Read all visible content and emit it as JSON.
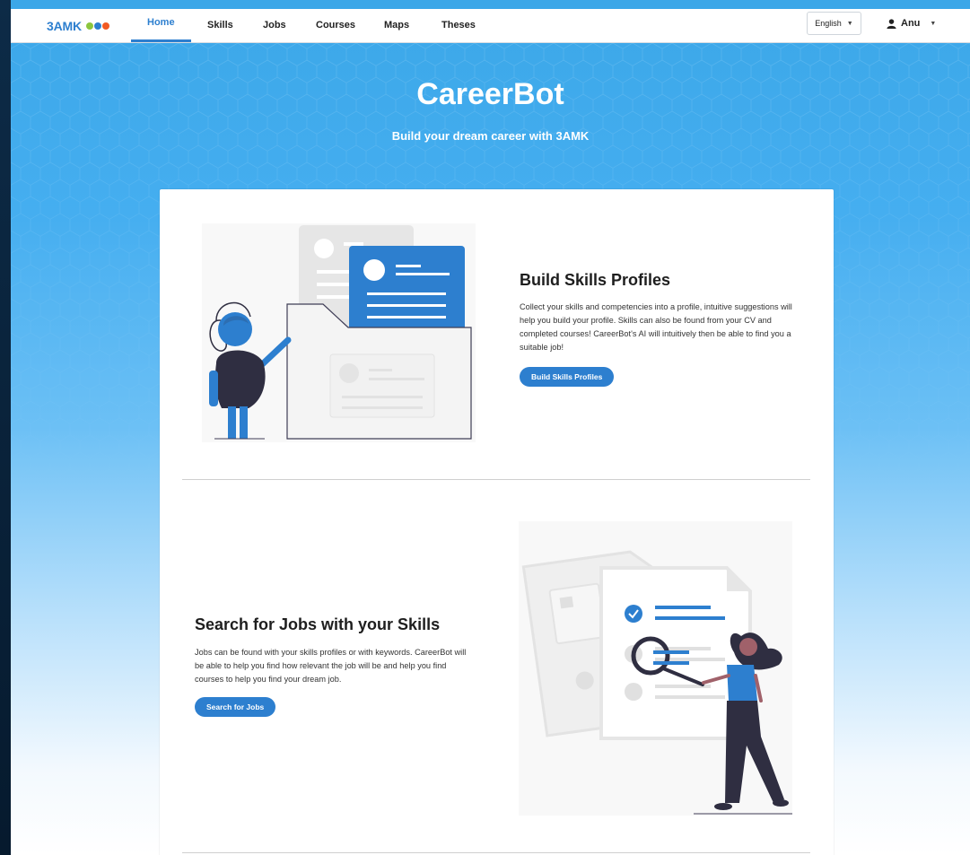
{
  "navbar": {
    "brand": "3AMK",
    "brand_dot_colors": [
      "#8cc63f",
      "#2d7fcf",
      "#f15a24"
    ],
    "links": [
      "Home",
      "Skills",
      "Jobs",
      "Courses",
      "Maps",
      "Theses"
    ],
    "active_link": "Home",
    "language": {
      "selected": "English"
    },
    "user": {
      "name": "Anu"
    }
  },
  "hero": {
    "title": "CareerBot",
    "subtitle": "Build your dream career with 3AMK"
  },
  "sections": [
    {
      "title": "Build Skills Profiles",
      "text": "Collect your skills and competencies into a profile, intuitive suggestions will help you build your profile. Skills can also be found from your CV and completed courses! CareerBot's AI will intuitively then be able to find you a suitable job!",
      "button": "Build Skills Profiles",
      "illustration_icon": "skills-profile-illustration-icon"
    },
    {
      "title": "Search for Jobs with your Skills",
      "text": "Jobs can be found with your skills profiles or with keywords. CareerBot will be able to help you find how relevant the job will be and help you find courses to help you find your dream job.",
      "button": "Search for Jobs",
      "illustration_icon": "job-search-illustration-icon"
    }
  ],
  "colors": {
    "accent": "#2d7fcf",
    "hero_top": "#3ba7e8",
    "illustration_dark": "#2f2e41",
    "illustration_grey": "#e6e6e6"
  }
}
